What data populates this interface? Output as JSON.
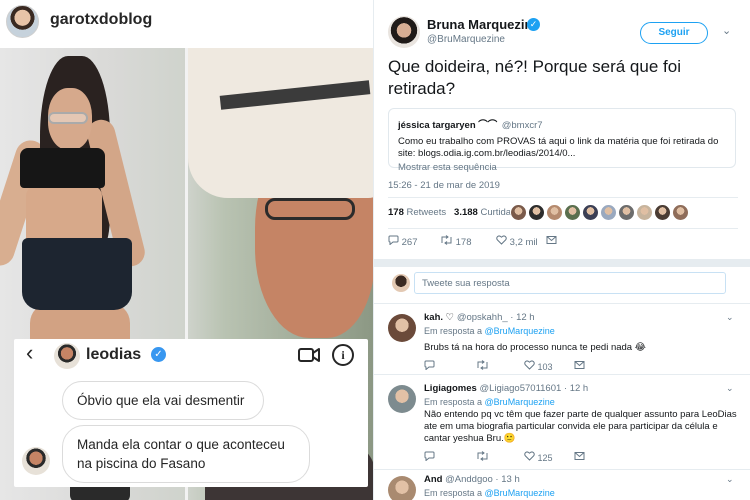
{
  "instagram": {
    "username": "garotxdoblog",
    "dm": {
      "back_glyph": "‹",
      "username": "leodias",
      "verified_glyph": "✓",
      "info_glyph": "i",
      "messages": [
        "Óbvio que ela vai desmentir",
        "Manda ela contar o que aconteceu na piscina do Fasano"
      ]
    }
  },
  "tweet": {
    "name": "Bruna Marquezine",
    "verified_glyph": "✓",
    "handle": "@BruMarquezine",
    "follow_label": "Seguir",
    "caret": "⌄",
    "text": "Que doideira, né?! Porque será que foi retirada?",
    "quote": {
      "name": "jéssica targaryen ⌒⌒",
      "handle": "@bmxcr7",
      "text": "Como eu trabalho com PROVAS tá aqui o link da matéria que foi retirada do site: blogs.odia.ig.com.br/leodias/2014/0...",
      "more": "Mostrar esta sequência"
    },
    "timestamp": "15:26 - 21 de mar de 2019",
    "retweets_count": "178",
    "retweets_label": "Retweets",
    "likes_count": "3.188",
    "likes_label": "Curtidas",
    "liker_colors": [
      "#7a5a4a",
      "#2d2d2d",
      "#b58a6e",
      "#5a6f4e",
      "#3b3f55",
      "#9aa9bf",
      "#6c6c6c",
      "#c7b49d",
      "#4a3c33",
      "#8f6d5a"
    ],
    "actions": {
      "replies": "267",
      "retweets": "178",
      "likes": "3,2 mil"
    },
    "reply_placeholder": "Tweete sua resposta",
    "replies": [
      {
        "name": "kah. ♡",
        "handle": "@opskahh_ · 12 h",
        "in_reply_prefix": "Em resposta a",
        "in_reply_handle": "@BruMarquezine",
        "text": "Brubs tá na hora do processo nunca te pedi nada 😂",
        "replies": "",
        "retweets": "",
        "likes": "103",
        "avatar_color": "#6b4a3a"
      },
      {
        "name": "Ligiagomes",
        "handle": "@Ligiago57011601 · 12 h",
        "in_reply_prefix": "Em resposta a",
        "in_reply_handle": "@BruMarquezine",
        "text": "Não entendo pq vc têm que fazer parte de qualquer assunto para LeoDias  ate em uma biografia particular convida ele para participar da célula e cantar yeshua Bru.🙂",
        "replies": "",
        "retweets": "",
        "likes": "125",
        "avatar_color": "#7d8b8f"
      },
      {
        "name": "And",
        "handle": "@Anddgoo · 13 h",
        "in_reply_prefix": "Em resposta a",
        "in_reply_handle": "@BruMarquezine",
        "text": "",
        "avatar_color": "#a98a70"
      }
    ]
  }
}
